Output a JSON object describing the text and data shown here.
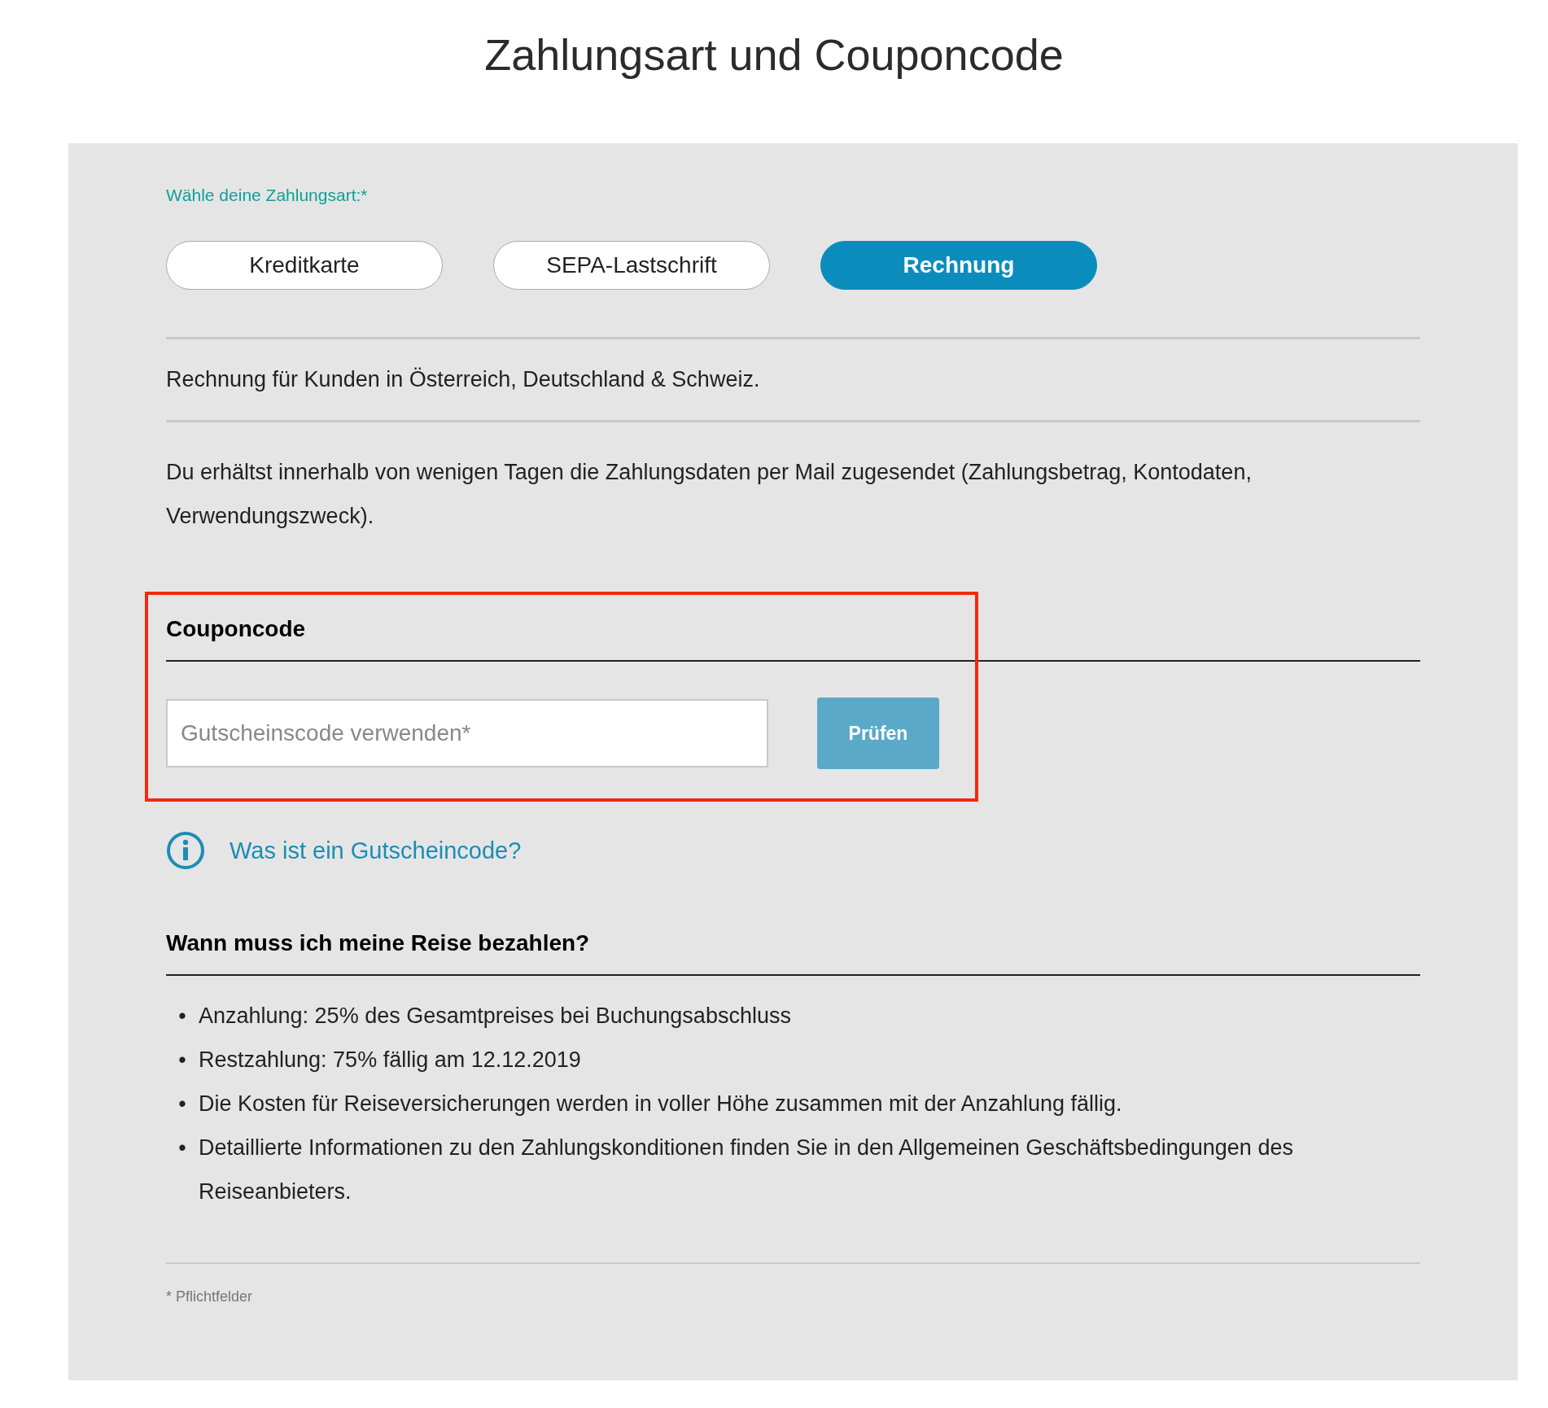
{
  "title": "Zahlungsart und Couponcode",
  "payment": {
    "label": "Wähle deine Zahlungsart:*",
    "options": [
      {
        "label": "Kreditkarte",
        "selected": false
      },
      {
        "label": "SEPA-Lastschrift",
        "selected": false
      },
      {
        "label": "Rechnung",
        "selected": true
      }
    ],
    "note": "Rechnung für Kunden in Österreich, Deutschland & Schweiz.",
    "description": "Du erhältst innerhalb von wenigen Tagen die Zahlungsdaten per Mail zugesendet (Zahlungsbetrag, Kontodaten, Verwendungszweck)."
  },
  "coupon": {
    "heading": "Couponcode",
    "highlighted": true,
    "placeholder": "Gutscheinscode verwenden*",
    "button": "Prüfen",
    "help_link": "Was ist ein Gutscheincode?"
  },
  "when": {
    "heading": "Wann muss ich meine Reise bezahlen?",
    "items": [
      {
        "bullet": "•",
        "text": "Anzahlung: 25% des Gesamtpreises bei Buchungsabschluss"
      },
      {
        "bullet": "•",
        "text": "Restzahlung: 75% fällig am 12.12.2019"
      },
      {
        "bullet": "•",
        "text": "Die Kosten für Reiseversicherungen werden in voller Höhe zusammen mit der Anzahlung fällig."
      },
      {
        "bullet": "•",
        "text": "Detaillierte Informationen zu den Zahlungskonditionen finden Sie in den Allgemeinen Geschäftsbedingungen des Reiseanbieters."
      }
    ]
  },
  "footnote": "* Pflichtfelder"
}
